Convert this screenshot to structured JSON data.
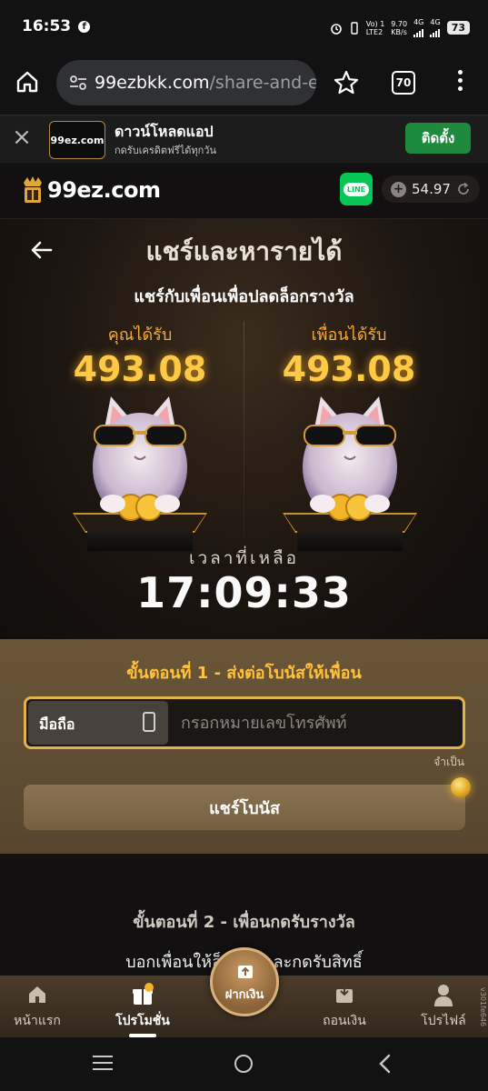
{
  "status_bar": {
    "time": "16:53",
    "fb_glyph": "f",
    "volte": "Vo) 1",
    "lte": "LTE2",
    "speed_top": "9.70",
    "speed_bottom": "KB/s",
    "net1": "4G",
    "net2": "4G",
    "battery": "73"
  },
  "browser": {
    "url_host": "99ezbkk.com",
    "url_path": "/share-and-e",
    "tab_count": "70"
  },
  "app_banner": {
    "logo_text": "99ez.com",
    "title": "ดาวน์โหลดแอป",
    "subtitle": "กดรับเครดิตฟรีได้ทุกวัน",
    "install_label": "ติดตั้ง"
  },
  "site_header": {
    "logo_text": "99ez.com",
    "line_label": "LINE",
    "balance": "54.97"
  },
  "hero": {
    "title": "แชร์และหารายได้",
    "subtitle": "แชร์กับเพื่อนเพื่อปลดล็อกรางวัล",
    "you_get_label": "คุณได้รับ",
    "you_get_value": "493.08",
    "friend_gets_label": "เพื่อนได้รับ",
    "friend_gets_value": "493.08",
    "time_left_label": "เวลาที่เหลือ",
    "countdown": "17:09:33"
  },
  "step1": {
    "title": "ขั้นตอนที่ 1 - ส่งต่อโบนัสให้เพื่อน",
    "contact_type": "มือถือ",
    "phone_placeholder": "กรอกหมายเลขโทรศัพท์",
    "required_note": "จำเป็น",
    "share_button": "แชร์โบนัส"
  },
  "step2": {
    "title": "ขั้นตอนที่ 2 - เพื่อนกดรับรางวัล",
    "subtitle": "บอกเพื่อนให้ล็อกอินและกดรับสิทธิ์"
  },
  "bottom_nav": {
    "home": "หน้าแรก",
    "promotions": "โปรโมชั่น",
    "deposit": "ฝากเงิน",
    "withdraw": "ถอนเงิน",
    "profile": "โปรไฟล์",
    "version": "v301fe646"
  },
  "colors": {
    "accent_gold": "#ffc845",
    "install_green": "#1e8a3e",
    "line_green": "#06c755",
    "panel_brown": "#6a5538"
  },
  "icons": [
    "home-icon",
    "star-icon",
    "tabs-icon",
    "menu-icon",
    "close-icon",
    "line-icon",
    "plus-icon",
    "refresh-icon",
    "back-arrow-icon",
    "cat-mascot-icon",
    "phone-icon",
    "coin-icon",
    "gift-icon",
    "deposit-icon",
    "wallet-icon",
    "user-icon"
  ]
}
